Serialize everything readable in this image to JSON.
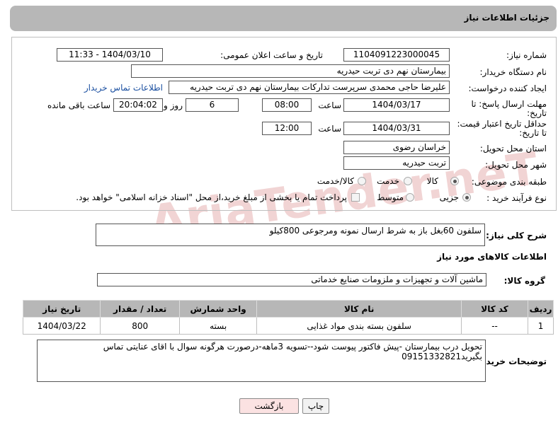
{
  "header": {
    "title": "جزئیات اطلاعات نیاز"
  },
  "form": {
    "need_number_label": "شماره نیاز:",
    "need_number": "1104091223000045",
    "announce_label": "تاریخ و ساعت اعلان عمومی:",
    "announce_value": "1404/03/10 - 11:33",
    "buyer_org_label": "نام دستگاه خریدار:",
    "buyer_org": "بیمارستان نهم دی تربت حیدریه",
    "requester_label": "ایجاد کننده درخواست:",
    "requester": "علیرضا حاجی محمدی سرپرست تدارکات بیمارستان نهم دی تربت حیدریه",
    "contact_link": "اطلاعات تماس خریدار",
    "deadline_label_1": "مهلت ارسال پاسخ: تا",
    "deadline_label_2": "تاریخ:",
    "deadline_date": "1404/03/17",
    "time_label": "ساعت",
    "deadline_time": "08:00",
    "days_value": "6",
    "days_label": "روز و",
    "remaining_time": "20:04:02",
    "remaining_label": "ساعت باقی مانده",
    "price_label_1": "حداقل تاریخ اعتبار قیمت:",
    "price_label_2": "تا تاریخ:",
    "price_date": "1404/03/31",
    "price_time": "12:00",
    "province_label": "استان محل تحویل:",
    "province": "خراسان رضوی",
    "city_label": "شهر محل تحویل:",
    "city": "تربت حیدریه",
    "category_label": "طبقه بندی موضوعی:",
    "category_options": [
      "کالا",
      "خدمت",
      "کالا/خدمت"
    ],
    "process_label": "نوع فرآیند خرید :",
    "process_options": [
      "جزیی",
      "متوسط"
    ],
    "payment_note": "پرداخت تمام یا بخشی از مبلغ خرید،از محل \"اسناد خزانه اسلامی\" خواهد بود."
  },
  "description": {
    "label": "شرح کلی نیاز:",
    "value": "سلفون 60بغل باز به شرط ارسال نمونه ومرجوعی 800کیلو"
  },
  "goods": {
    "section_title": "اطلاعات کالاهای مورد نیاز",
    "group_label": "گروه کالا:",
    "group_value": "ماشین آلات و تجهیزات و ملزومات صنایع خدماتی",
    "columns": [
      "ردیف",
      "کد کالا",
      "نام کالا",
      "واحد شمارش",
      "تعداد / مقدار",
      "تاریخ نیاز"
    ],
    "rows": [
      {
        "row": "1",
        "code": "--",
        "name": "سلفون بسته بندی مواد غذایی",
        "unit": "بسته",
        "qty": "800",
        "date": "1404/03/22"
      }
    ]
  },
  "buyer_notes": {
    "label": "توضیحات خریدار:",
    "line1": "تحویل درب بیمارستان -پیش فاکتور پیوست شود--تسویه 3ماهه-درصورت هرگونه سوال با اقای عنایتی تماس",
    "line2": "بگیرید09151332821"
  },
  "buttons": {
    "print": "چاپ",
    "back": "بازگشت"
  },
  "watermark": "AriaTender.neT"
}
